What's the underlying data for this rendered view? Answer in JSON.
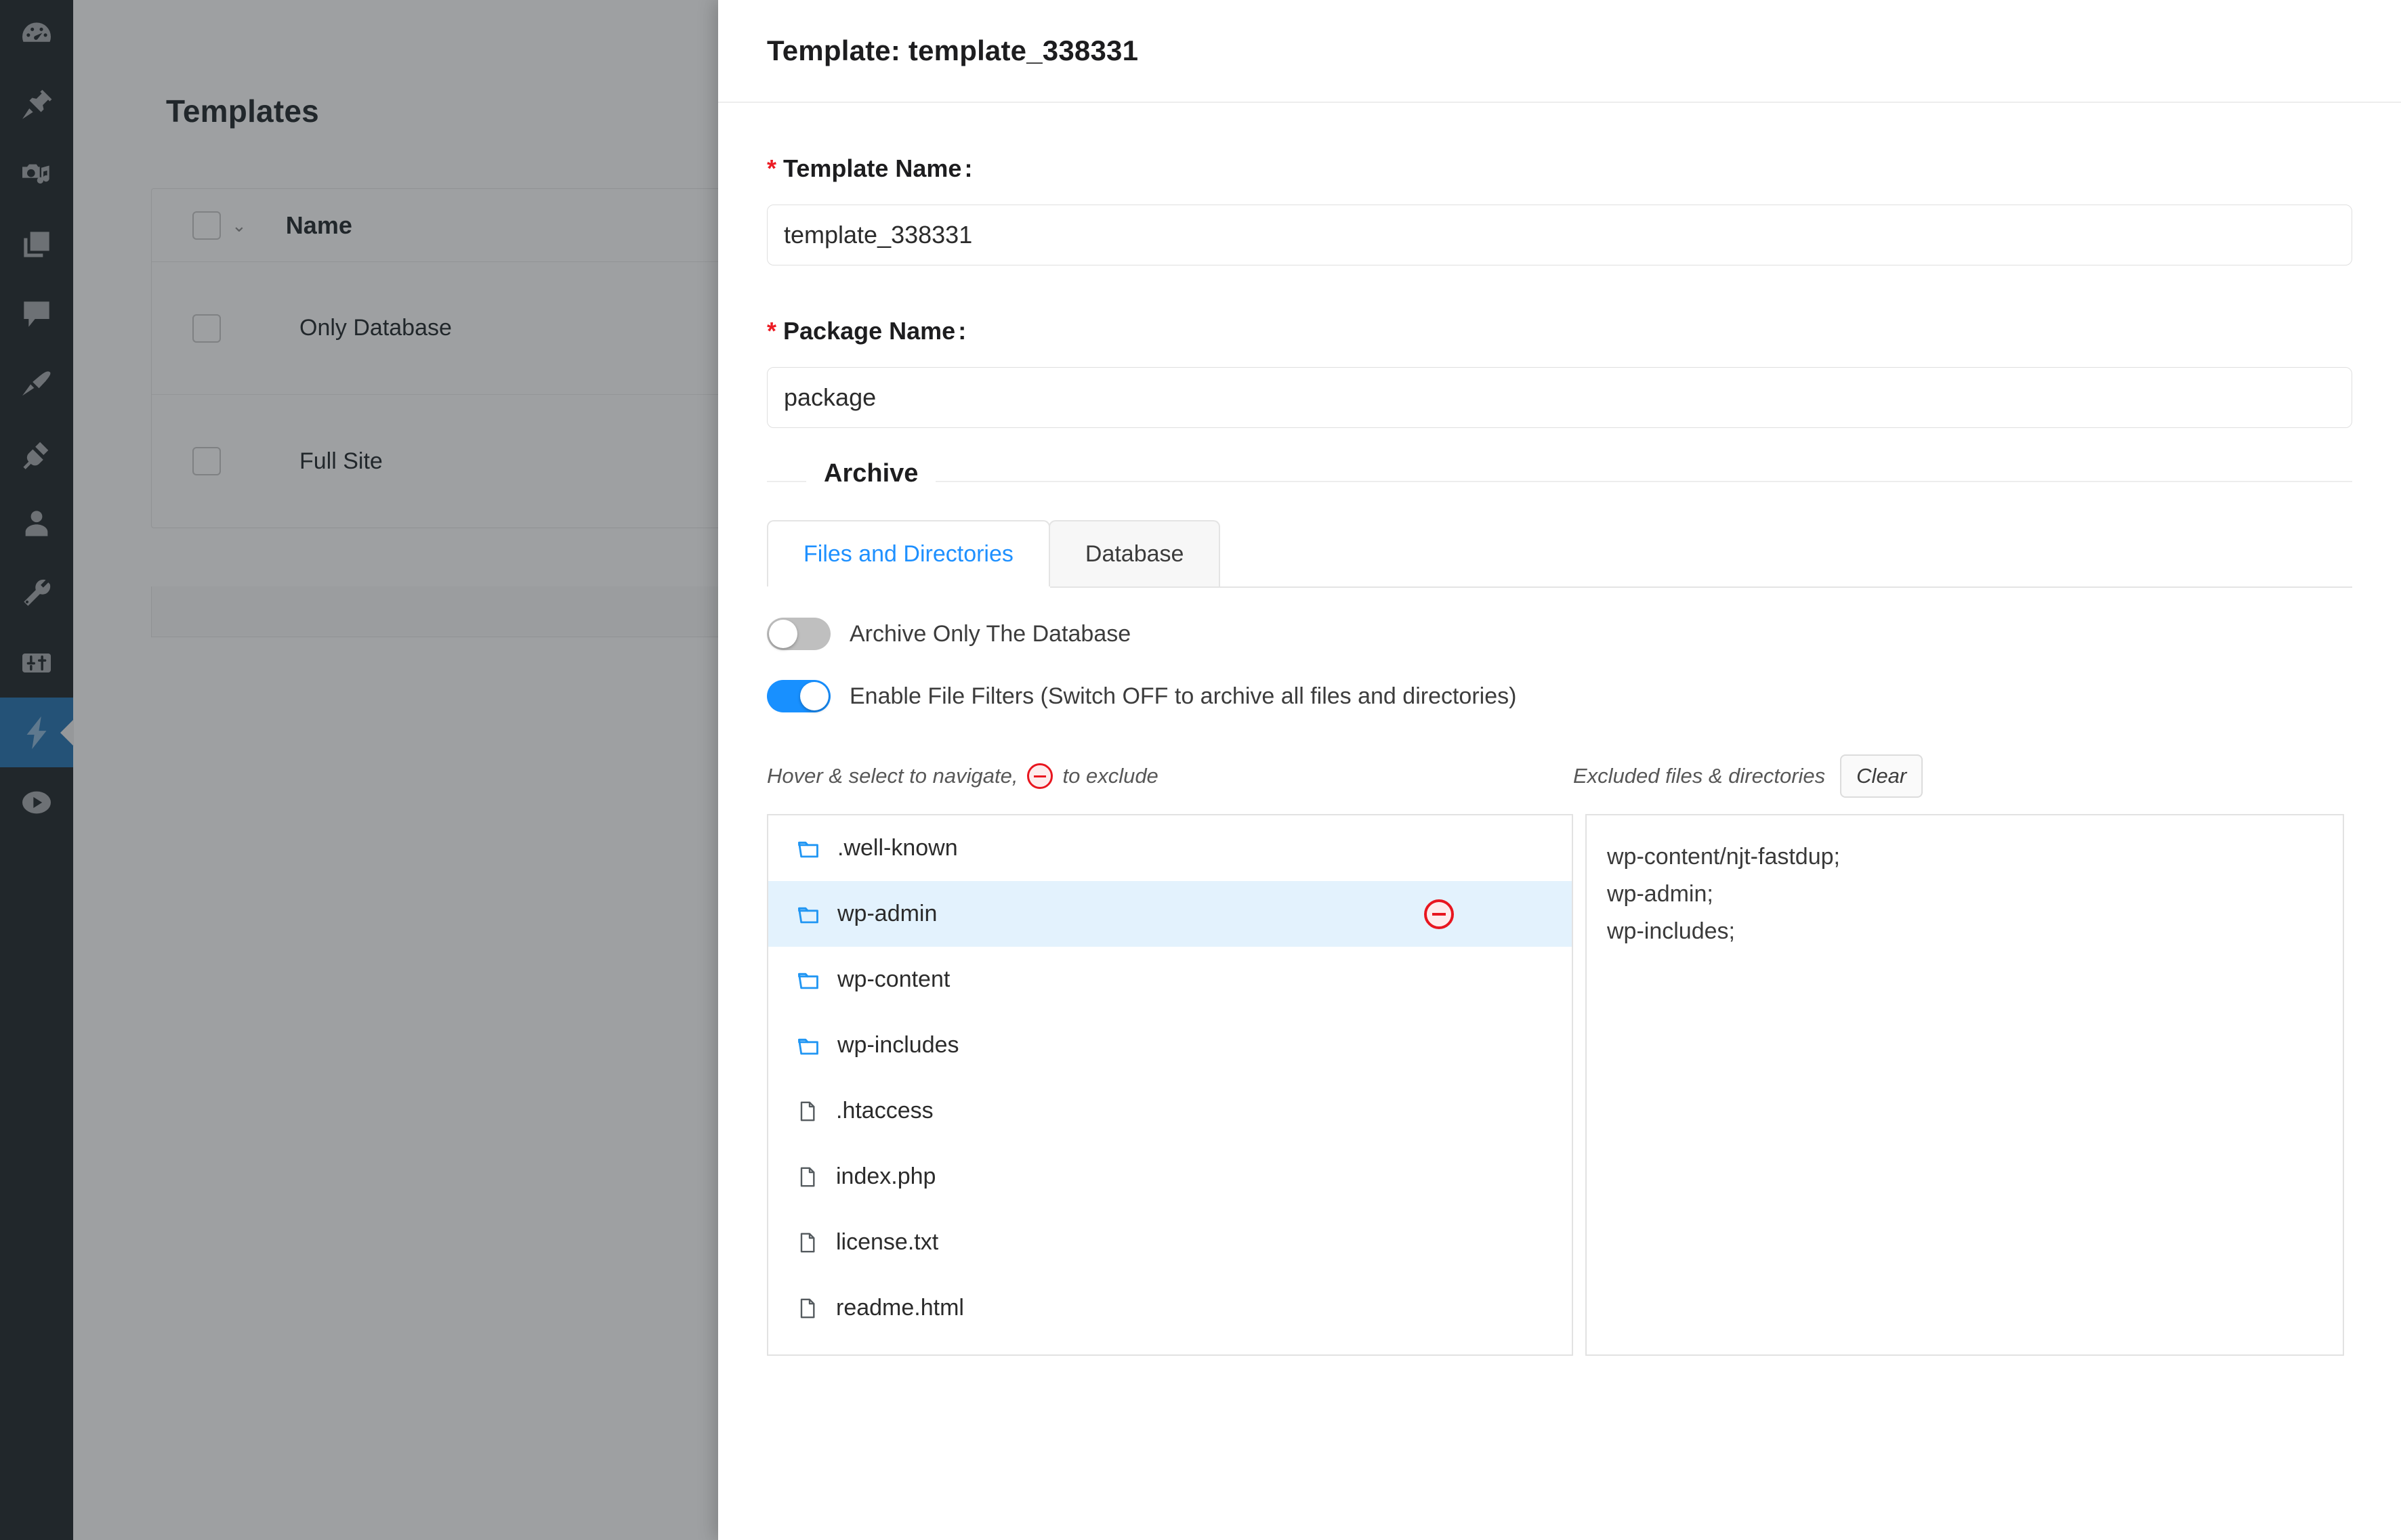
{
  "wp_sidebar": {
    "items": [
      {
        "icon": "dashboard-gauge-icon",
        "active": false
      },
      {
        "icon": "pin-posts-icon",
        "active": false
      },
      {
        "icon": "media-camera-music-icon",
        "active": false
      },
      {
        "icon": "pages-copy-icon",
        "active": false
      },
      {
        "icon": "comments-bubble-icon",
        "active": false
      },
      {
        "icon": "appearance-brush-icon",
        "active": false
      },
      {
        "icon": "plugins-plug-icon",
        "active": false
      },
      {
        "icon": "users-person-icon",
        "active": false
      },
      {
        "icon": "tools-wrench-icon",
        "active": false
      },
      {
        "icon": "settings-sliders-icon",
        "active": false
      },
      {
        "icon": "lightning-bolt-icon",
        "active": true
      },
      {
        "icon": "play-circle-icon",
        "active": false
      }
    ]
  },
  "background_page": {
    "title": "Templates",
    "table": {
      "columns": [
        "Name"
      ],
      "rows": [
        {
          "name": "Only Database"
        },
        {
          "name": "Full Site"
        }
      ]
    }
  },
  "drawer": {
    "title": "Template: template_338331",
    "fields": {
      "template_name": {
        "star": "*",
        "label": "Template Name",
        "colon": ":",
        "value": "template_338331",
        "placeholder": "Template Name"
      },
      "package_name": {
        "star": "*",
        "label": "Package Name",
        "colon": ":",
        "value": "package",
        "placeholder": "Package Name"
      }
    },
    "archive": {
      "legend": "Archive",
      "tabs": [
        {
          "label": "Files and Directories",
          "active": true
        },
        {
          "label": "Database",
          "active": false
        }
      ],
      "toggles": [
        {
          "label": "Archive Only The Database",
          "on": false
        },
        {
          "label": "Enable File Filters (Switch OFF to archive all files and directories)",
          "on": true
        }
      ],
      "hints": {
        "left_before": "Hover & select to navigate,",
        "left_after": "to exclude",
        "right_label": "Excluded files & directories",
        "clear_label": "Clear"
      },
      "file_list": [
        {
          "name": ".well-known",
          "type": "folder",
          "selected": false
        },
        {
          "name": "wp-admin",
          "type": "folder",
          "selected": true
        },
        {
          "name": "wp-content",
          "type": "folder",
          "selected": false
        },
        {
          "name": "wp-includes",
          "type": "folder",
          "selected": false
        },
        {
          "name": ".htaccess",
          "type": "file",
          "selected": false
        },
        {
          "name": "index.php",
          "type": "file",
          "selected": false
        },
        {
          "name": "license.txt",
          "type": "file",
          "selected": false
        },
        {
          "name": "readme.html",
          "type": "file",
          "selected": false
        }
      ],
      "excluded_text": "wp-content/njt-fastdup;\nwp-admin;\nwp-includes;"
    }
  },
  "colors": {
    "accent_blue": "#1890ff",
    "tab_active_text": "#1e90ff",
    "sidebar_active": "#2271b1",
    "sidebar_bg": "#1d2327",
    "required_star": "#ec1c24",
    "exclude_red": "#e8161f",
    "row_selected": "#e3f2fd",
    "folder_icon": "#2196f3"
  }
}
